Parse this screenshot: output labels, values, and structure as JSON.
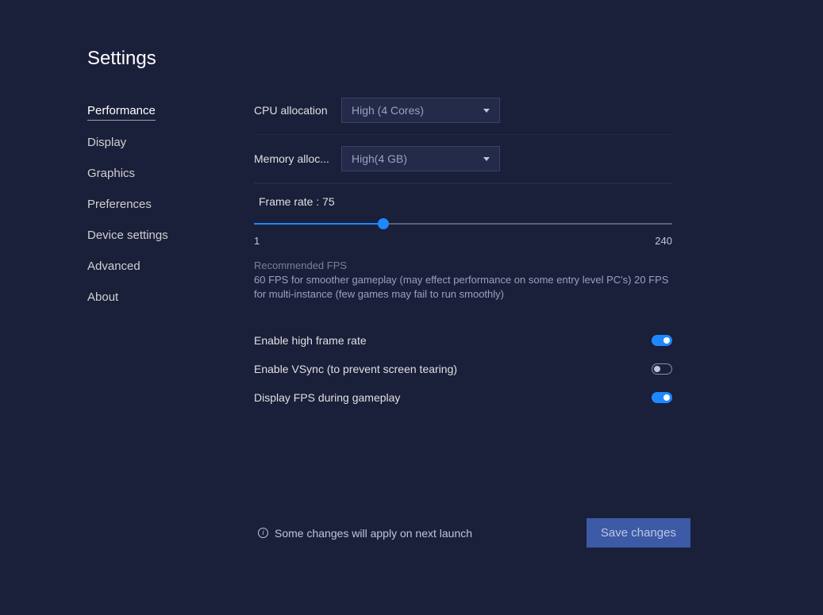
{
  "title": "Settings",
  "sidebar": {
    "items": [
      {
        "label": "Performance",
        "active": true
      },
      {
        "label": "Display",
        "active": false
      },
      {
        "label": "Graphics",
        "active": false
      },
      {
        "label": "Preferences",
        "active": false
      },
      {
        "label": "Device settings",
        "active": false
      },
      {
        "label": "Advanced",
        "active": false
      },
      {
        "label": "About",
        "active": false
      }
    ]
  },
  "cpu": {
    "label": "CPU allocation",
    "value": "High (4 Cores)"
  },
  "memory": {
    "label": "Memory alloc...",
    "value": "High(4 GB)"
  },
  "frame_rate": {
    "label_prefix": "Frame rate : ",
    "value": 75,
    "min": 1,
    "max": 240,
    "min_label": "1",
    "max_label": "240",
    "recommend_title": "Recommended FPS",
    "recommend_text": "60 FPS for smoother gameplay (may effect performance on some entry level PC's) 20 FPS for multi-instance (few games may fail to run smoothly)"
  },
  "toggles": {
    "high_frame": {
      "label": "Enable high frame rate",
      "on": true
    },
    "vsync": {
      "label": "Enable VSync (to prevent screen tearing)",
      "on": false
    },
    "display_fps": {
      "label": "Display FPS during gameplay",
      "on": true
    }
  },
  "footer": {
    "note": "Some changes will apply on next launch",
    "save": "Save changes"
  }
}
